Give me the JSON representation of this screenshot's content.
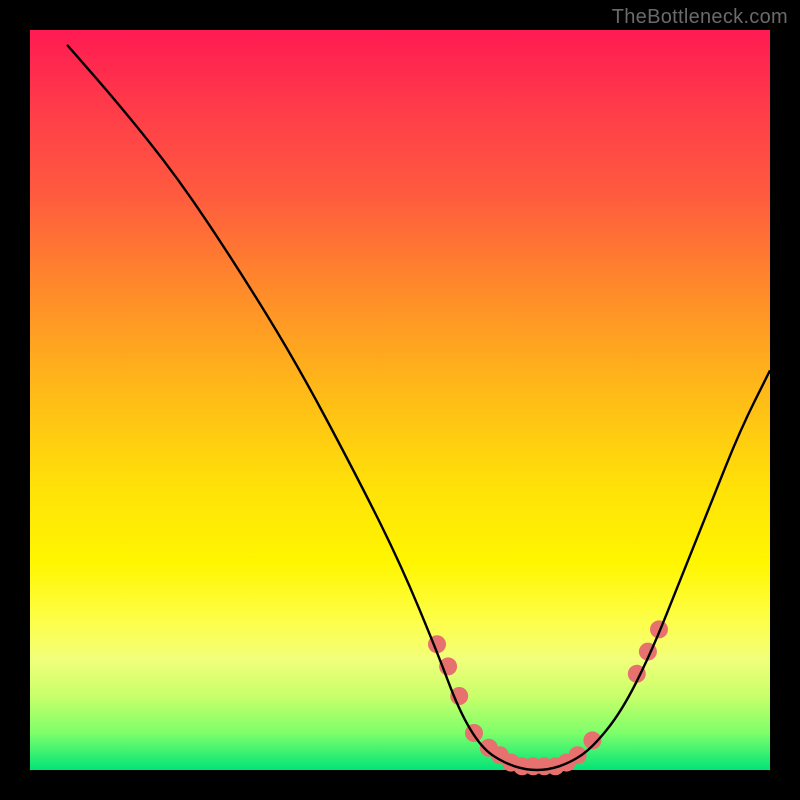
{
  "watermark": "TheBottleneck.com",
  "chart_data": {
    "type": "line",
    "title": "",
    "xlabel": "",
    "ylabel": "",
    "xlim": [
      0,
      100
    ],
    "ylim": [
      0,
      100
    ],
    "curve": {
      "x": [
        5,
        12,
        20,
        28,
        36,
        44,
        50,
        55,
        58,
        61,
        64,
        67,
        70,
        73,
        76,
        80,
        84,
        88,
        92,
        96,
        100
      ],
      "y": [
        98,
        90,
        80,
        68,
        55,
        40,
        28,
        16,
        8,
        3,
        1,
        0,
        0,
        1,
        3,
        8,
        16,
        26,
        36,
        46,
        54
      ]
    },
    "highlight_points": {
      "x": [
        55,
        56.5,
        58,
        60,
        62,
        63.5,
        65,
        66.5,
        68,
        69.5,
        71,
        72.5,
        74,
        76,
        82,
        83.5,
        85
      ],
      "y": [
        17,
        14,
        10,
        5,
        3,
        2,
        1,
        0.5,
        0.5,
        0.5,
        0.5,
        1,
        2,
        4,
        13,
        16,
        19
      ],
      "color": "#e7716e",
      "radius_px": 9
    },
    "colors": {
      "curve": "#000000",
      "gradient_top": "#ff1a52",
      "gradient_mid": "#ffe208",
      "gradient_bottom": "#00e477",
      "background": "#000000"
    }
  }
}
